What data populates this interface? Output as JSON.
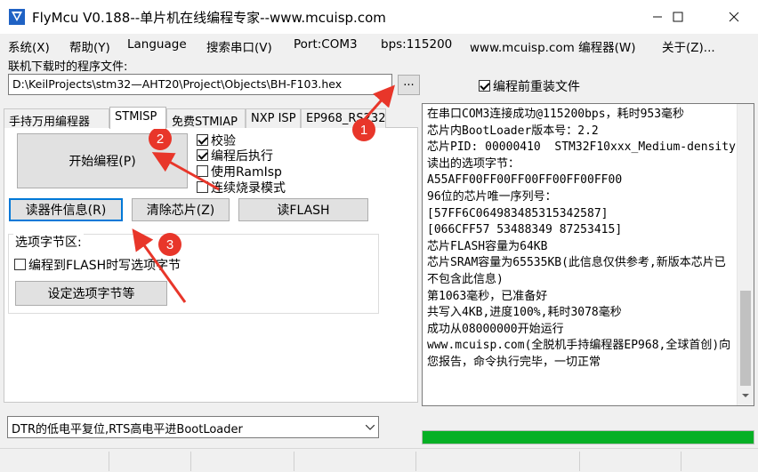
{
  "window": {
    "title": "FlyMcu V0.188--单片机在线编程专家--www.mcuisp.com"
  },
  "menu": {
    "items": [
      "系统(X)",
      "帮助(Y)",
      "Language",
      "搜索串口(V)",
      "Port:COM3",
      "bps:115200",
      "www.mcuisp.com 编程器(W)",
      "关于(Z)..."
    ]
  },
  "program": {
    "label": "联机下载时的程序文件:",
    "path": "D:\\KeilProjects\\stm32—AHT20\\Project\\Objects\\BH-F103.hex",
    "browse_label": "...",
    "reload_label": "编程前重装文件",
    "reload_checked": true
  },
  "tabs": [
    "手持万用编程器",
    "STMISP",
    "免费STMIAP",
    "NXP ISP",
    "EP968_RS232"
  ],
  "stmisp": {
    "start_label": "开始编程(P)",
    "options": [
      {
        "label": "校验",
        "checked": true
      },
      {
        "label": "编程后执行",
        "checked": true
      },
      {
        "label": "使用RamIsp",
        "checked": false
      },
      {
        "label": "连续烧录模式",
        "checked": false
      }
    ],
    "read_info_label": "读器件信息(R)",
    "clear_chip_label": "清除芯片(Z)",
    "read_flash_label": "读FLASH",
    "optbyte_title": "选项字节区:",
    "flash_opt_label": "编程到FLASH时写选项字节",
    "set_opt_label": "设定选项字节等"
  },
  "reset_mode": "DTR的低电平复位,RTS高电平进BootLoader",
  "log": "在串口COM3连接成功@115200bps，耗时953毫秒\n芯片内BootLoader版本号：2.2\n芯片PID: 00000410  STM32F10xxx_Medium-density\n读出的选项字节：\nA55AFF00FF00FF00FF00FF00FF00\n96位的芯片唯一序列号：\n[57FF6C064983485315342587]\n[066CFF57 53488349 87253415]\n芯片FLASH容量为64KB\n芯片SRAM容量为65535KB(此信息仅供参考,新版本芯片已不包含此信息)\n第1063毫秒，已准备好\n共写入4KB,进度100%,耗时3078毫秒\n成功从08000000开始运行\nwww.mcuisp.com(全脱机手持编程器EP968,全球首创)向您报告，命令执行完毕，一切正常",
  "progress_percent": 100,
  "annotations": {
    "badges": [
      "1",
      "2",
      "3"
    ],
    "color": "#e8362a"
  },
  "colors": {
    "progress": "#06b025",
    "focus": "#0078d7"
  }
}
